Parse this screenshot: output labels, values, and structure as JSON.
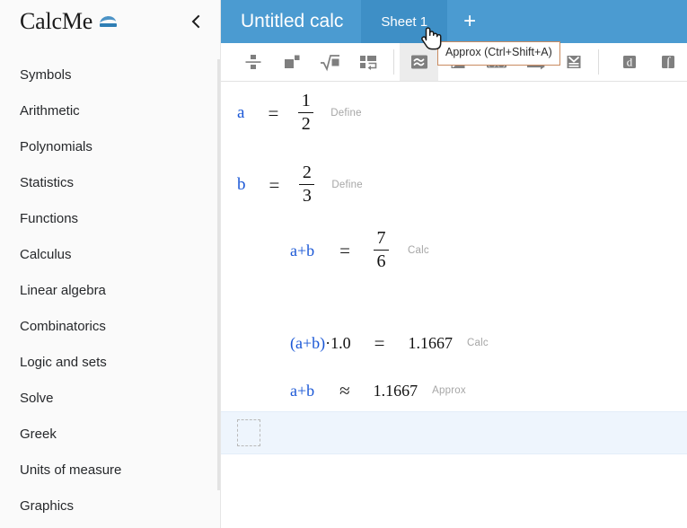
{
  "app": {
    "brand_name": "CalcMe",
    "brand_mark_icon": "approx-equals-logo"
  },
  "sidebar": {
    "collapse_icon": "chevron-left-icon",
    "items": [
      {
        "label": "Symbols"
      },
      {
        "label": "Arithmetic"
      },
      {
        "label": "Polynomials"
      },
      {
        "label": "Statistics"
      },
      {
        "label": "Functions"
      },
      {
        "label": "Calculus"
      },
      {
        "label": "Linear algebra"
      },
      {
        "label": "Combinatorics"
      },
      {
        "label": "Logic and sets"
      },
      {
        "label": "Solve"
      },
      {
        "label": "Greek"
      },
      {
        "label": "Units of measure"
      },
      {
        "label": "Graphics"
      }
    ]
  },
  "topbar": {
    "document_title": "Untitled calc",
    "tabs": [
      {
        "label": "Sheet 1",
        "active": true
      }
    ],
    "add_sheet_label": "+",
    "background_color": "#4b9bd1",
    "active_tab_color": "#3e8fc6"
  },
  "toolbar": {
    "buttons": [
      {
        "name": "fraction-icon",
        "title": "Fraction"
      },
      {
        "name": "power-icon",
        "title": "Power"
      },
      {
        "name": "square-root-icon",
        "title": "Square root"
      },
      {
        "name": "matrix-icon",
        "title": "Matrix"
      },
      {
        "name": "approx-icon",
        "title": "Approx",
        "active": true
      },
      {
        "name": "simplify-icon",
        "title": "Simplify"
      },
      {
        "name": "expand-icon",
        "title": "Expand"
      },
      {
        "name": "substitute-icon",
        "title": "Substitute"
      },
      {
        "name": "solve-icon",
        "title": "Solve"
      },
      {
        "name": "derivative-icon",
        "title": "Derivative"
      },
      {
        "name": "integral-icon",
        "title": "Integral"
      }
    ]
  },
  "tooltip": {
    "text": "Approx (Ctrl+Shift+A)",
    "border_color": "#c98a5f"
  },
  "sheet": {
    "rows": [
      {
        "id": "row-define-a",
        "lhs": "a",
        "relation": "=",
        "rhs_type": "fraction",
        "numerator": "1",
        "denominator": "2",
        "tag": "Define"
      },
      {
        "id": "row-define-b",
        "lhs": "b",
        "relation": "=",
        "rhs_type": "fraction",
        "numerator": "2",
        "denominator": "3",
        "tag": "Define"
      },
      {
        "id": "row-calc-sum",
        "lhs": "a+b",
        "relation": "=",
        "rhs_type": "fraction",
        "numerator": "7",
        "denominator": "6",
        "tag": "Calc"
      },
      {
        "id": "row-calc-product",
        "lhs": "(a+b)·1.0",
        "relation": "=",
        "rhs_type": "value",
        "value": "1.1667",
        "tag": "Calc"
      },
      {
        "id": "row-approx-sum",
        "lhs": "a+b",
        "relation": "≈",
        "rhs_type": "value",
        "value": "1.1667",
        "tag": "Approx"
      }
    ],
    "active_row": {
      "placeholder_slot": "empty-input-slot",
      "highlight_color": "#eef5fd"
    }
  }
}
